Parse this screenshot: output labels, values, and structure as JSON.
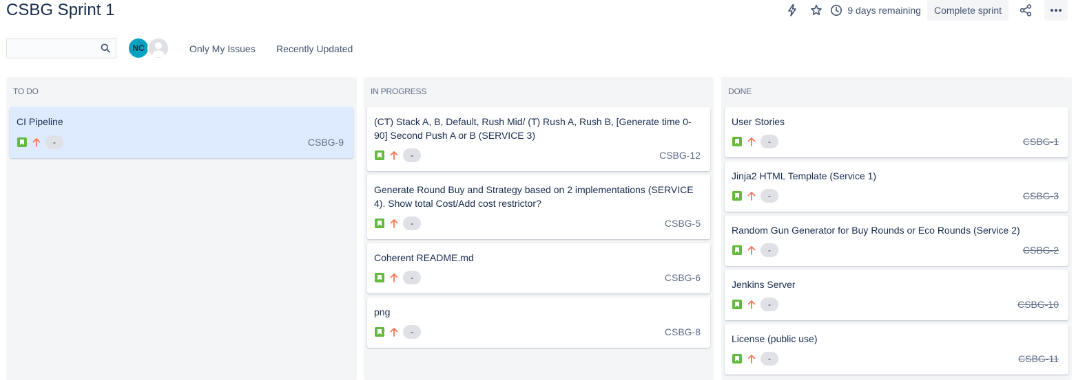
{
  "header": {
    "title": "CSBG Sprint 1",
    "remaining": "9 days remaining",
    "complete_label": "Complete sprint"
  },
  "toolbar": {
    "search_placeholder": "",
    "avatar_initials": "NC",
    "filters": [
      "Only My Issues",
      "Recently Updated"
    ]
  },
  "columns": [
    {
      "title": "TO DO",
      "cards": [
        {
          "summary": "CI Pipeline",
          "estimate": "-",
          "key": "CSBG-9",
          "selected": true
        }
      ]
    },
    {
      "title": "IN PROGRESS",
      "cards": [
        {
          "summary": "(CT) Stack A, B, Default, Rush Mid/ (T) Rush A, Rush B, [Generate time 0-90] Second Push A or B (SERVICE 3)",
          "estimate": "-",
          "key": "CSBG-12"
        },
        {
          "summary": "Generate Round Buy and Strategy based on 2 implementations (SERVICE 4). Show total Cost/Add cost restrictor?",
          "estimate": "-",
          "key": "CSBG-5"
        },
        {
          "summary": "Coherent README.md",
          "estimate": "-",
          "key": "CSBG-6"
        },
        {
          "summary": "png",
          "estimate": "-",
          "key": "CSBG-8"
        }
      ]
    },
    {
      "title": "DONE",
      "cards": [
        {
          "summary": "User Stories",
          "estimate": "-",
          "key": "CSBG-1"
        },
        {
          "summary": "Jinja2 HTML Template (Service 1)",
          "estimate": "-",
          "key": "CSBG-3"
        },
        {
          "summary": "Random Gun Generator for Buy Rounds or Eco Rounds (Service 2)",
          "estimate": "-",
          "key": "CSBG-2"
        },
        {
          "summary": "Jenkins Server",
          "estimate": "-",
          "key": "CSBG-10"
        },
        {
          "summary": "License (public use)",
          "estimate": "-",
          "key": "CSBG-11"
        }
      ]
    }
  ],
  "colors": {
    "story": "#63ba3c",
    "priority_high": "#ff7452",
    "avatar": "#00a3bf",
    "column_bg": "#f4f5f7",
    "selected_card": "#deebff"
  },
  "icons": {
    "story": "bookmark-icon",
    "priority": "arrow-up-icon",
    "automation": "lightning-icon",
    "star": "star-icon",
    "clock": "clock-icon",
    "share": "share-icon",
    "more": "ellipsis-icon",
    "search": "search-icon"
  }
}
